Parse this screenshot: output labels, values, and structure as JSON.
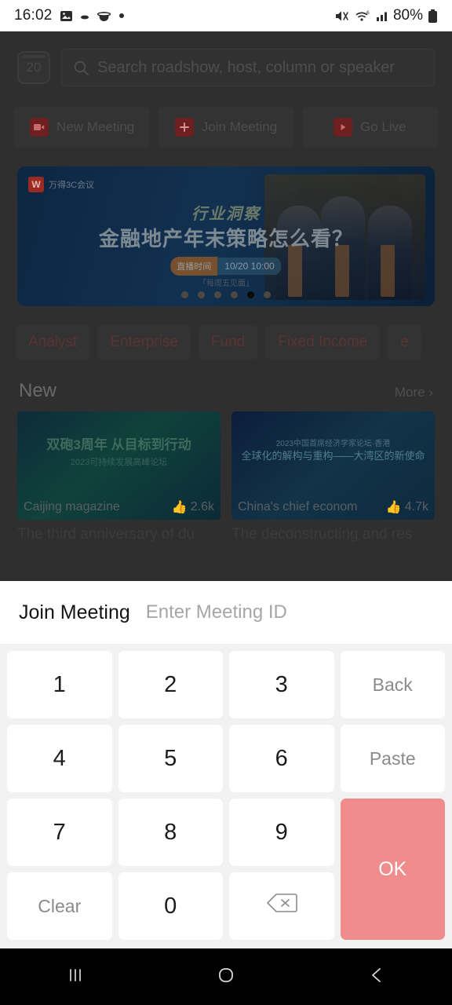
{
  "status_bar": {
    "time": "16:02",
    "battery_percent": "80%",
    "icons": [
      "image-icon",
      "cloud-icon",
      "ellipse-icon",
      "dot-icon",
      "mute-icon",
      "wifi-icon",
      "cellular-signal-icon",
      "battery-icon"
    ]
  },
  "app": {
    "calendar_button_day": "20",
    "search": {
      "placeholder": "Search roadshow, host, column or speaker",
      "icon": "search-icon"
    },
    "actions": [
      {
        "label": "New Meeting",
        "icon": "video-camera-icon",
        "glyph": "■"
      },
      {
        "label": "Join Meeting",
        "icon": "plus-icon",
        "glyph": "+"
      },
      {
        "label": "Go Live",
        "icon": "play-icon",
        "glyph": "▶"
      }
    ],
    "banner": {
      "logo_mark": "W",
      "logo_text": "万得3C会议",
      "subtitle": "行业洞察",
      "title": "金融地产年末策略怎么看？",
      "time_label": "直播时间",
      "time_value": "10/20 10:00",
      "footer": "「每周五见面」",
      "dot_count": 6,
      "active_dot": 5
    },
    "categories": [
      "Analyst",
      "Enterprise",
      "Fund",
      "Fixed Income",
      "e"
    ],
    "section": {
      "title": "New",
      "more_label": "More",
      "more_icon": "chevron-right-icon"
    },
    "cards": [
      {
        "host": "Caijing magazine",
        "likes": "2.6k",
        "like_icon": "thumbs-up-icon",
        "title": "The third anniversary of du",
        "cover_title": "双砲3周年 从目标到行动",
        "cover_sub": "2023可持续发展高峰论坛"
      },
      {
        "host": "China's chief econom",
        "likes": "4.7k",
        "like_icon": "thumbs-up-icon",
        "title": "The deconstructing and res",
        "cover_title": "2023中国首席经济学家论坛·香港",
        "cover_sub": "全球化的解构与重构——大湾区的新使命"
      }
    ]
  },
  "sheet": {
    "title": "Join Meeting",
    "input_placeholder": "Enter Meeting ID",
    "input_value": "",
    "keys": [
      {
        "label": "1",
        "name": "key-1",
        "type": "digit"
      },
      {
        "label": "2",
        "name": "key-2",
        "type": "digit"
      },
      {
        "label": "3",
        "name": "key-3",
        "type": "digit"
      },
      {
        "label": "Back",
        "name": "key-back",
        "type": "word"
      },
      {
        "label": "4",
        "name": "key-4",
        "type": "digit"
      },
      {
        "label": "5",
        "name": "key-5",
        "type": "digit"
      },
      {
        "label": "6",
        "name": "key-6",
        "type": "digit"
      },
      {
        "label": "Paste",
        "name": "key-paste",
        "type": "word"
      },
      {
        "label": "7",
        "name": "key-7",
        "type": "digit"
      },
      {
        "label": "8",
        "name": "key-8",
        "type": "digit"
      },
      {
        "label": "9",
        "name": "key-9",
        "type": "digit"
      },
      {
        "label": "Clear",
        "name": "key-clear",
        "type": "word"
      },
      {
        "label": "0",
        "name": "key-0",
        "type": "digit"
      },
      {
        "label": "",
        "name": "key-backspace",
        "type": "delete",
        "icon": "backspace-icon"
      }
    ],
    "ok_label": "OK",
    "ok_color": "#F08C8C"
  },
  "navbar": {
    "recents_icon": "recents-icon",
    "home_icon": "home-icon",
    "back_icon": "back-icon"
  }
}
